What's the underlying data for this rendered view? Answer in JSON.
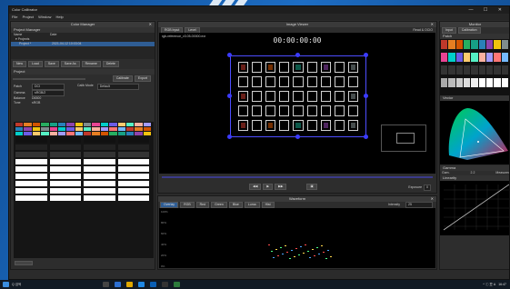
{
  "app": {
    "title": "Color Calibrator",
    "menu": [
      "File",
      "Project",
      "Window",
      "Help"
    ]
  },
  "color_manager": {
    "header": "Color Manager",
    "project_manager": "Project Manager",
    "list_headers": [
      "Name",
      "Date"
    ],
    "root_item": "Projects",
    "project_item": {
      "name": "Project *",
      "date": "2021-04-12 10:03:04"
    },
    "buttons": [
      "New",
      "Load",
      "Save",
      "Save As",
      "Rename",
      "Delete"
    ],
    "project_section": "Project",
    "calibrate_button": "Calibrate",
    "export_button": "Export",
    "fields": [
      {
        "label": "Patch",
        "value": "DCI"
      },
      {
        "label": "Gamma",
        "value": "sRGB/2"
      },
      {
        "label": "Balance",
        "value": "D6500"
      },
      {
        "label": "Tone",
        "value": "sRGB"
      }
    ],
    "cal_mode_label": "Calib Mode",
    "cal_mode_value": "Default"
  },
  "image_viewer": {
    "header": "Image Viewer",
    "tabs": [
      "RGB Input",
      "Level"
    ],
    "filename": "rgb-reference_v3.05-00000.exr",
    "timecode": "00:00:00:00",
    "right_label": "Read & OCIO",
    "exposure_label": "Exposure"
  },
  "waveform": {
    "header": "Waveform",
    "tabs": [
      "Overlay",
      "RGB",
      "Red",
      "Green",
      "Blue",
      "Luma",
      "Hist"
    ],
    "intensity_label": "Intensity",
    "intensity_value": "25",
    "levels": [
      "100%",
      "80%",
      "60%",
      "40%",
      "20%",
      "0%"
    ]
  },
  "monitor": {
    "header": "Monitor",
    "tabs": [
      "Input",
      "Calibration"
    ],
    "swatch_section": "Patch",
    "vector_section": "Vector",
    "gamma_section": "Gamma",
    "linearity_section": "Linearity",
    "gamma_values": [
      {
        "label": "Gam.",
        "value": "2.2"
      },
      {
        "label": "Measured",
        "value": "2.2/12.2"
      },
      {
        "label": "Dev.",
        "value": "0.03"
      }
    ],
    "linearity_axis": [
      "0",
      "1",
      "2",
      "3",
      "4",
      "5",
      "6",
      "7",
      "8",
      "9",
      "10",
      "11",
      "12"
    ]
  },
  "taskbar": {
    "search_label": "Q 검색",
    "time": "16:47",
    "date": "2021-04-12",
    "tray": "^ ⓘ 豆 A"
  },
  "colors": {
    "accent": "#3b3bff",
    "panel_bg": "#2d2d2d",
    "checker_swatches": [
      "#c0392b",
      "#e67e22",
      "#d35400",
      "#27ae60",
      "#16a085",
      "#2980b9",
      "#8e44ad",
      "#f1c40f",
      "#7f8c8d",
      "#e84393",
      "#00cec9",
      "#6c5ce7",
      "#fdcb6e",
      "#55efc4",
      "#fab1a0",
      "#a29bfe",
      "#ff7675",
      "#74b9ff"
    ]
  }
}
